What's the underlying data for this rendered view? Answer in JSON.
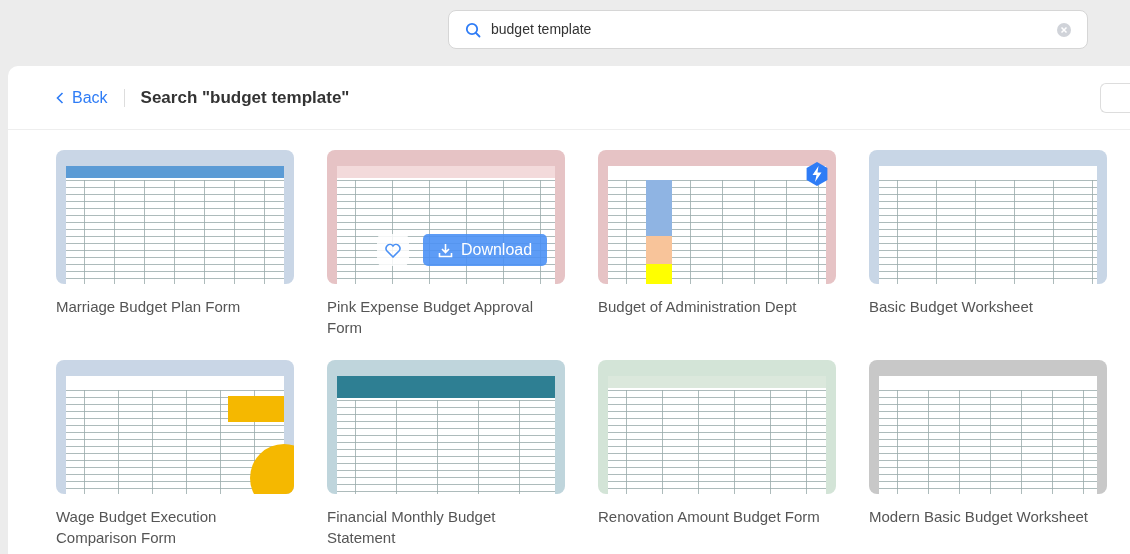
{
  "search": {
    "value": "budget template"
  },
  "header": {
    "back": "Back",
    "title": "Search \"budget template\""
  },
  "templates": [
    {
      "title": "Marriage Budget Plan Form",
      "premium": false,
      "hovered": false
    },
    {
      "title": "Pink Expense Budget Approval Form",
      "premium": false,
      "hovered": true
    },
    {
      "title": "Budget of Administration Dept",
      "premium": true,
      "hovered": false
    },
    {
      "title": "Basic Budget Worksheet",
      "premium": false,
      "hovered": false
    },
    {
      "title": "Wage Budget Execution Comparison Form",
      "premium": false,
      "hovered": false
    },
    {
      "title": "Financial Monthly Budget Statement",
      "premium": false,
      "hovered": false
    },
    {
      "title": "Renovation Amount Budget Form",
      "premium": false,
      "hovered": false
    },
    {
      "title": "Modern Basic Budget Worksheet",
      "premium": false,
      "hovered": false
    }
  ],
  "overlay": {
    "download": "Download"
  }
}
